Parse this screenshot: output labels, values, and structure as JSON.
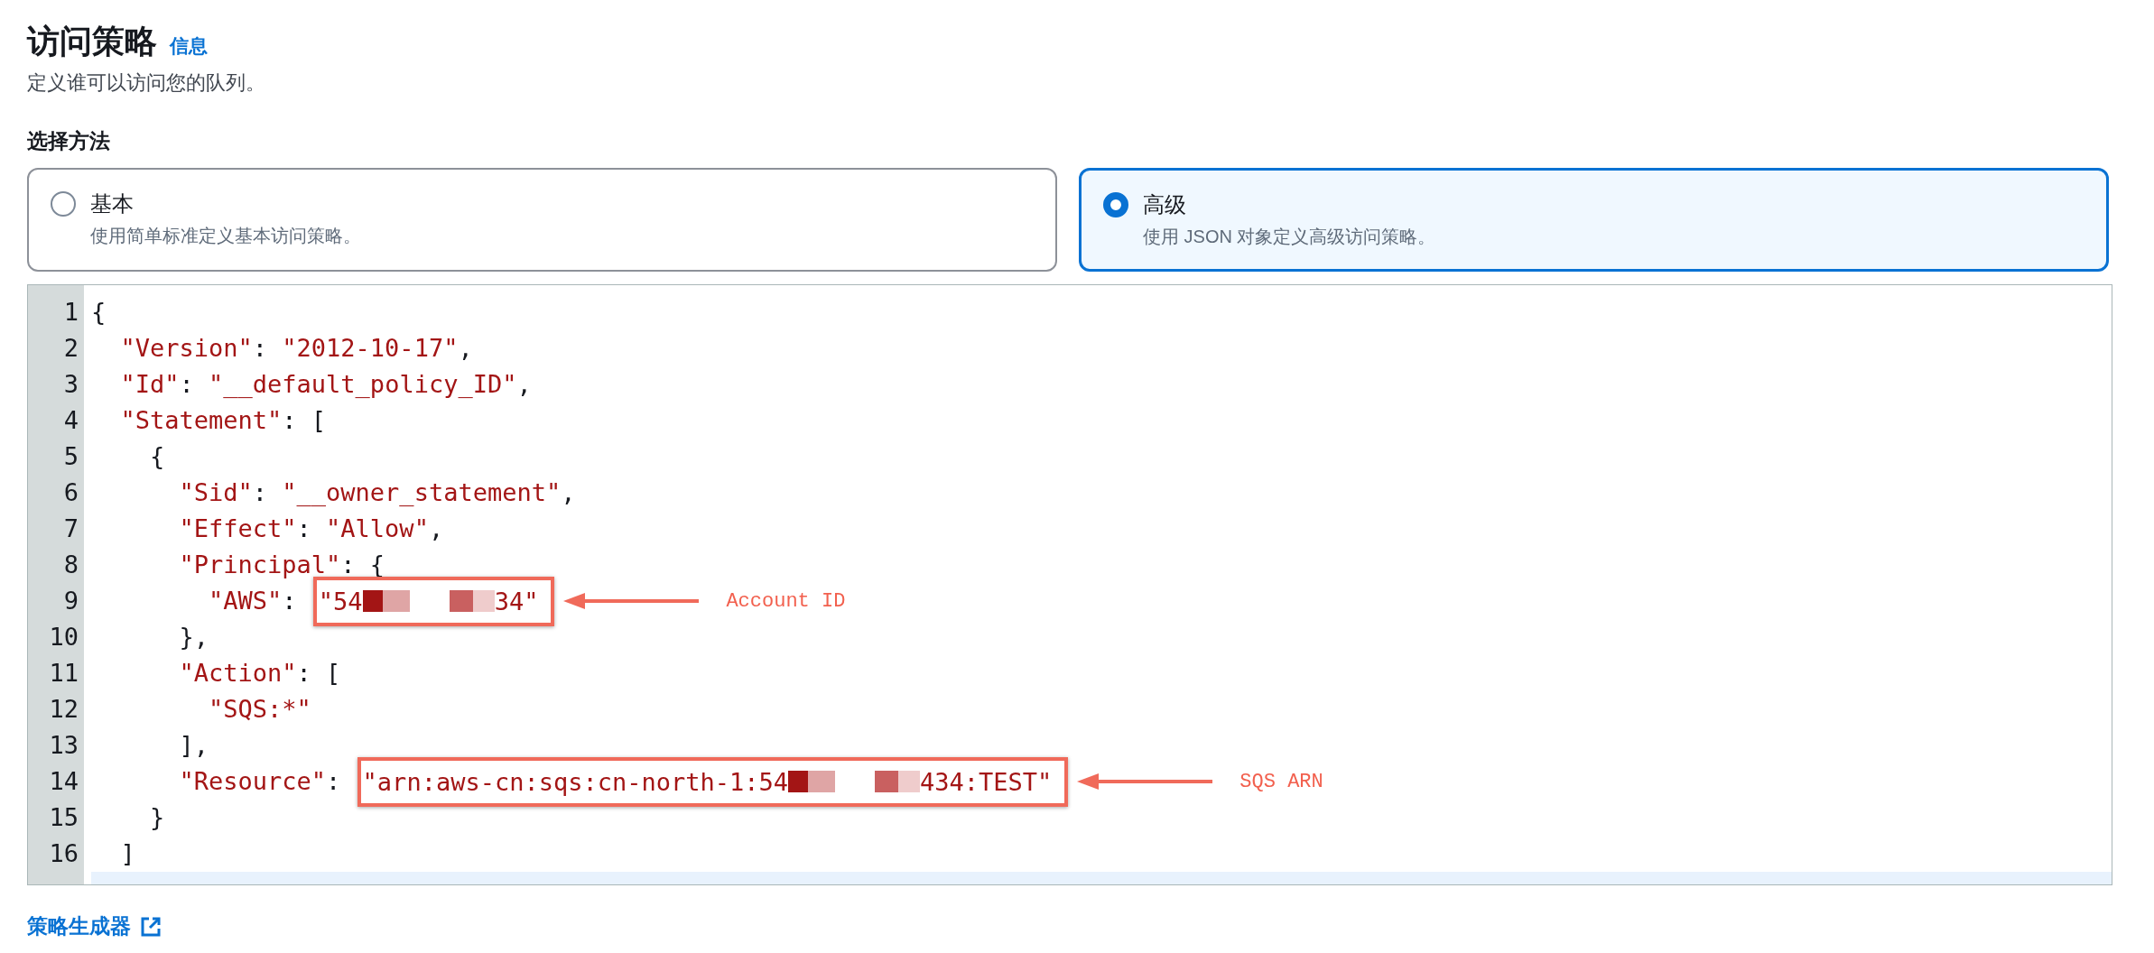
{
  "section": {
    "title": "访问策略",
    "info_link": "信息",
    "description": "定义谁可以访问您的队列。"
  },
  "method": {
    "label": "选择方法",
    "options": [
      {
        "title": "基本",
        "description": "使用简单标准定义基本访问策略。",
        "selected": false
      },
      {
        "title": "高级",
        "description": "使用 JSON 对象定义高级访问策略。",
        "selected": true
      }
    ]
  },
  "editor": {
    "lines": [
      {
        "number": "1",
        "tokens": [
          {
            "kind": "punct",
            "text": "{"
          }
        ]
      },
      {
        "number": "2",
        "tokens": [
          {
            "kind": "key",
            "text": "  \"Version\""
          },
          {
            "kind": "punct",
            "text": ": "
          },
          {
            "kind": "string",
            "text": "\"2012-10-17\""
          },
          {
            "kind": "punct",
            "text": ","
          }
        ]
      },
      {
        "number": "3",
        "tokens": [
          {
            "kind": "key",
            "text": "  \"Id\""
          },
          {
            "kind": "punct",
            "text": ": "
          },
          {
            "kind": "string",
            "text": "\"__default_policy_ID\""
          },
          {
            "kind": "punct",
            "text": ","
          }
        ]
      },
      {
        "number": "4",
        "tokens": [
          {
            "kind": "key",
            "text": "  \"Statement\""
          },
          {
            "kind": "punct",
            "text": ": ["
          }
        ]
      },
      {
        "number": "5",
        "tokens": [
          {
            "kind": "punct",
            "text": "    {"
          }
        ]
      },
      {
        "number": "6",
        "tokens": [
          {
            "kind": "key",
            "text": "      \"Sid\""
          },
          {
            "kind": "punct",
            "text": ": "
          },
          {
            "kind": "string",
            "text": "\"__owner_statement\""
          },
          {
            "kind": "punct",
            "text": ","
          }
        ]
      },
      {
        "number": "7",
        "tokens": [
          {
            "kind": "key",
            "text": "      \"Effect\""
          },
          {
            "kind": "punct",
            "text": ": "
          },
          {
            "kind": "string",
            "text": "\"Allow\""
          },
          {
            "kind": "punct",
            "text": ","
          }
        ]
      },
      {
        "number": "8",
        "tokens": [
          {
            "kind": "key",
            "text": "      \"Principal\""
          },
          {
            "kind": "punct",
            "text": ": {"
          }
        ]
      },
      {
        "number": "9",
        "tokens": [
          {
            "kind": "key",
            "text": "        \"AWS\""
          },
          {
            "kind": "punct",
            "text": ": "
          }
        ],
        "boxed": [
          {
            "kind": "string",
            "text": "\"54"
          },
          {
            "kind": "redacted"
          },
          {
            "kind": "string",
            "text": "34\""
          }
        ],
        "callout": "Account ID"
      },
      {
        "number": "10",
        "tokens": [
          {
            "kind": "punct",
            "text": "      },"
          }
        ]
      },
      {
        "number": "11",
        "tokens": [
          {
            "kind": "key",
            "text": "      \"Action\""
          },
          {
            "kind": "punct",
            "text": ": ["
          }
        ]
      },
      {
        "number": "12",
        "tokens": [
          {
            "kind": "string",
            "text": "        \"SQS:*\""
          }
        ]
      },
      {
        "number": "13",
        "tokens": [
          {
            "kind": "punct",
            "text": "      ],"
          }
        ]
      },
      {
        "number": "14",
        "tokens": [
          {
            "kind": "key",
            "text": "      \"Resource\""
          },
          {
            "kind": "punct",
            "text": ": "
          }
        ],
        "boxed": [
          {
            "kind": "string",
            "text": "\"arn:aws-cn:sqs:cn-north-1:54"
          },
          {
            "kind": "redacted"
          },
          {
            "kind": "string",
            "text": "434:TEST\""
          }
        ],
        "callout": "SQS ARN"
      },
      {
        "number": "15",
        "tokens": [
          {
            "kind": "punct",
            "text": "    }"
          }
        ]
      },
      {
        "number": "16",
        "tokens": [
          {
            "kind": "punct",
            "text": "  ]"
          }
        ]
      }
    ]
  },
  "footer_link": "策略生成器"
}
